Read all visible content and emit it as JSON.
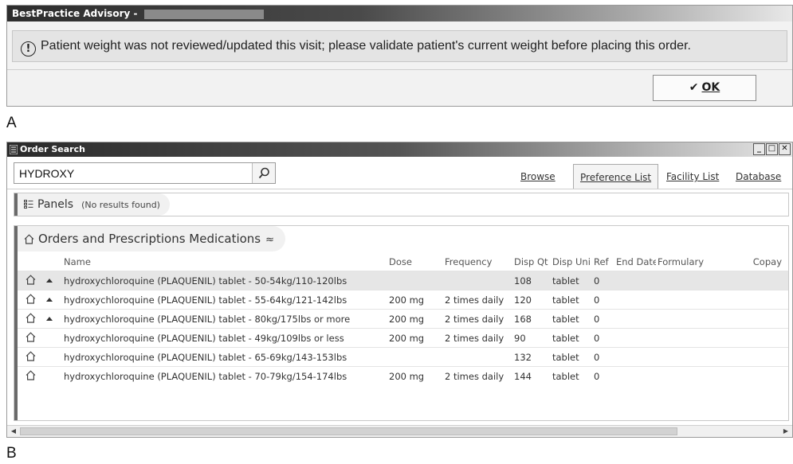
{
  "advisory": {
    "title": "BestPractice Advisory -",
    "message": "Patient weight was not reviewed/updated this visit; please validate patient's current weight before placing this order.",
    "ok_label": "OK"
  },
  "labels": {
    "panel_a": "A",
    "panel_b": "B"
  },
  "order_search": {
    "title": "Order Search",
    "search": {
      "value": "HYDROXY"
    },
    "tabs": [
      {
        "label": "Browse",
        "active": false
      },
      {
        "label": "Preference List",
        "active": true
      },
      {
        "label": "Facility List",
        "active": false
      },
      {
        "label": "Database",
        "active": false
      }
    ],
    "panels": {
      "label": "Panels",
      "status": "(No results found)"
    },
    "orders": {
      "label": "Orders and Prescriptions Medications",
      "columns": [
        "Name",
        "Dose",
        "Frequency",
        "Disp Qt",
        "Disp Uni",
        "Ref",
        "End Date",
        "Formulary",
        "Copay"
      ],
      "rows": [
        {
          "name": "hydroxychloroquine (PLAQUENIL) tablet - 50-54kg/110-120lbs",
          "dose": "",
          "frequency": "",
          "qty": "108",
          "unit": "tablet",
          "ref": "0",
          "pref": true,
          "selected": true
        },
        {
          "name": "hydroxychloroquine (PLAQUENIL) tablet - 55-64kg/121-142lbs",
          "dose": "200 mg",
          "frequency": "2 times daily",
          "qty": "120",
          "unit": "tablet",
          "ref": "0",
          "pref": true,
          "selected": false
        },
        {
          "name": "hydroxychloroquine (PLAQUENIL) tablet - 80kg/175lbs or more",
          "dose": "200 mg",
          "frequency": "2 times daily",
          "qty": "168",
          "unit": "tablet",
          "ref": "0",
          "pref": true,
          "selected": false
        },
        {
          "name": "hydroxychloroquine (PLAQUENIL) tablet - 49kg/109lbs or less",
          "dose": "200 mg",
          "frequency": "2 times daily",
          "qty": "90",
          "unit": "tablet",
          "ref": "0",
          "pref": false,
          "selected": false
        },
        {
          "name": "hydroxychloroquine (PLAQUENIL) tablet - 65-69kg/143-153lbs",
          "dose": "",
          "frequency": "",
          "qty": "132",
          "unit": "tablet",
          "ref": "0",
          "pref": false,
          "selected": false
        },
        {
          "name": "hydroxychloroquine (PLAQUENIL) tablet - 70-79kg/154-174lbs",
          "dose": "200 mg",
          "frequency": "2 times daily",
          "qty": "144",
          "unit": "tablet",
          "ref": "0",
          "pref": false,
          "selected": false
        }
      ]
    }
  },
  "icons": {
    "warning": "exclamation-circle-icon",
    "ok": "checkmark-icon",
    "search": "magnifier-icon",
    "panels": "panels-list-icon",
    "orders": "home-icon",
    "row": "home-icon",
    "preference": "up-arrow-icon",
    "collapse": "double-chevron-up-icon"
  }
}
